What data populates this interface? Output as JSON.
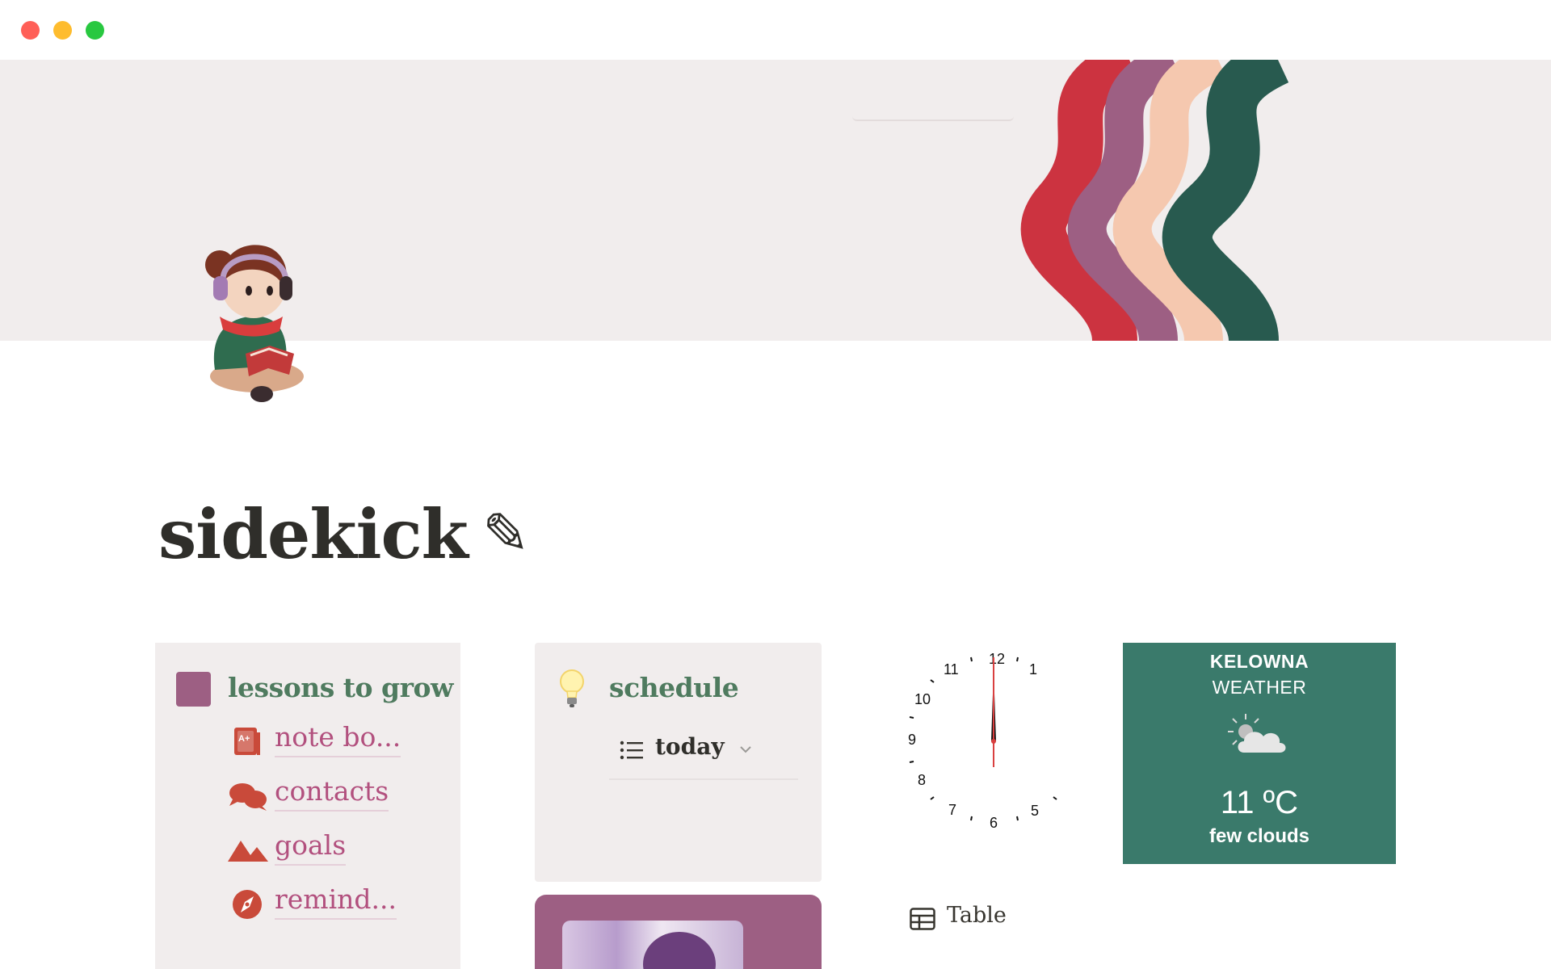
{
  "window": {
    "controls": [
      "close",
      "minimize",
      "maximize"
    ]
  },
  "page": {
    "title": "sidekick",
    "title_emoji": "✎",
    "icon": "girl-reading-icon"
  },
  "lessons_card": {
    "heading": "lessons to grow",
    "links": [
      {
        "label": "note bo...",
        "icon": "notebook-grade-icon"
      },
      {
        "label": "contacts",
        "icon": "chat-bubbles-icon"
      },
      {
        "label": "goals",
        "icon": "mountains-icon"
      },
      {
        "label": "remind...",
        "icon": "compass-icon"
      }
    ]
  },
  "schedule_card": {
    "heading": "schedule",
    "icon": "lightbulb-icon",
    "view": {
      "label": "today",
      "icon": "list-icon"
    }
  },
  "clock": {
    "numbers": [
      "12",
      "1",
      "5",
      "6",
      "7",
      "8",
      "9",
      "10",
      "11"
    ]
  },
  "weather": {
    "city": "KELOWNA",
    "label": "WEATHER",
    "temperature": "11 ºC",
    "description": "few clouds",
    "icon": "partly-cloudy-icon"
  },
  "table_link": {
    "label": "Table",
    "icon": "table-icon"
  },
  "colors": {
    "cover_bg": "#f1eded",
    "stripe_red": "#cc3340",
    "stripe_purple": "#9d5f83",
    "stripe_peach": "#f5c8af",
    "stripe_green": "#285a4f",
    "heading_green": "#4f7b5f",
    "link_pink": "#b2507e",
    "weather_bg": "#3a7a6b"
  }
}
